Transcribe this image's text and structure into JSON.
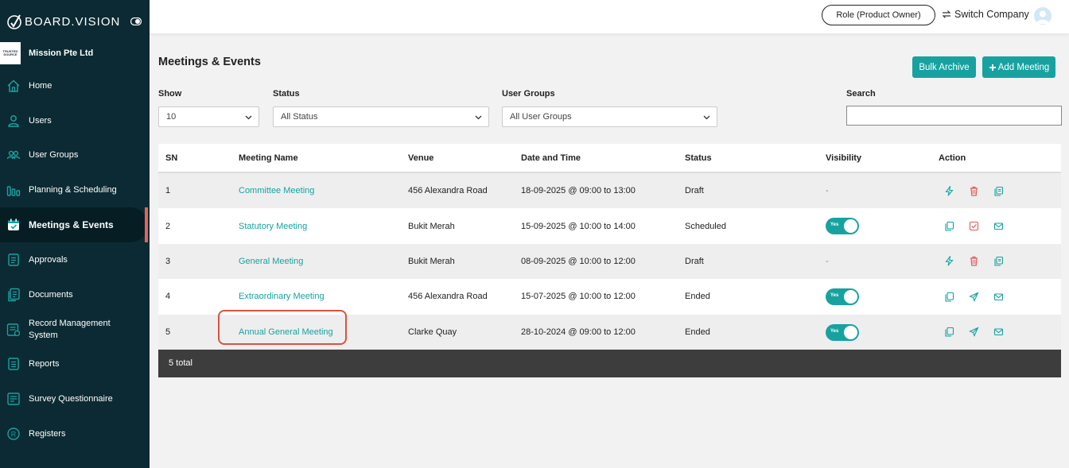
{
  "brand": {
    "name": "BOARD.VISION"
  },
  "company": {
    "name": "Mission Pte Ltd",
    "logo_text": "TRUSTED SOURCE"
  },
  "sidebar": {
    "items": [
      {
        "label": "Home",
        "icon": "home-icon"
      },
      {
        "label": "Users",
        "icon": "user-icon"
      },
      {
        "label": "User Groups",
        "icon": "user-groups-icon"
      },
      {
        "label": "Planning & Scheduling",
        "icon": "planning-icon"
      },
      {
        "label": "Meetings & Events",
        "icon": "calendar-icon",
        "active": true
      },
      {
        "label": "Approvals",
        "icon": "approvals-icon"
      },
      {
        "label": "Documents",
        "icon": "documents-icon"
      },
      {
        "label": "Record Management System",
        "icon": "record-management-icon"
      },
      {
        "label": "Reports",
        "icon": "reports-icon"
      },
      {
        "label": "Survey Questionnaire",
        "icon": "survey-icon"
      },
      {
        "label": "Registers",
        "icon": "registers-icon"
      }
    ]
  },
  "topbar": {
    "role_label": "Role (Product Owner)",
    "switch_label": "Switch Company"
  },
  "page": {
    "title": "Meetings & Events",
    "bulk_archive": "Bulk Archive",
    "add_meeting": "Add Meeting"
  },
  "filters": {
    "show_label": "Show",
    "show_value": "10",
    "status_label": "Status",
    "status_value": "All Status",
    "groups_label": "User Groups",
    "groups_value": "All User Groups",
    "search_label": "Search",
    "search_value": ""
  },
  "table": {
    "headers": {
      "sn": "SN",
      "name": "Meeting Name",
      "venue": "Venue",
      "datetime": "Date and Time",
      "status": "Status",
      "visibility": "Visibility",
      "action": "Action"
    },
    "rows": [
      {
        "sn": "1",
        "name": "Committee Meeting",
        "venue": "456 Alexandra Road",
        "datetime": "18-09-2025 @ 09:00 to 13:00",
        "status": "Draft",
        "visibility": "-"
      },
      {
        "sn": "2",
        "name": "Statutory Meeting",
        "venue": "Bukit Merah",
        "datetime": "15-09-2025 @ 10:00 to 14:00",
        "status": "Scheduled",
        "visibility": "Yes"
      },
      {
        "sn": "3",
        "name": "General Meeting",
        "venue": "Bukit Merah",
        "datetime": "08-09-2025 @ 10:00 to 12:00",
        "status": "Draft",
        "visibility": "-"
      },
      {
        "sn": "4",
        "name": "Extraordinary Meeting",
        "venue": "456 Alexandra Road",
        "datetime": "15-07-2025 @ 10:00 to 12:00",
        "status": "Ended",
        "visibility": "Yes"
      },
      {
        "sn": "5",
        "name": "Annual General Meeting",
        "venue": "Clarke Quay",
        "datetime": "28-10-2024 @ 09:00 to 12:00",
        "status": "Ended",
        "visibility": "Yes"
      }
    ],
    "footer": "5 total"
  },
  "colors": {
    "sidebar": "#0c2a33",
    "accent": "#17a2a0",
    "active_marker": "#e3635a",
    "delete": "#e05a5a",
    "highlight": "#d9533f"
  }
}
